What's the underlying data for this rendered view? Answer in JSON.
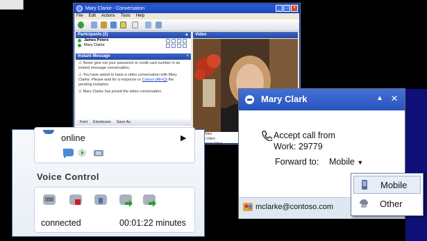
{
  "conversation_window": {
    "title": "Mary Clarke - Conversation",
    "menu": [
      "File",
      "Edit",
      "Actions",
      "Tools",
      "Help"
    ],
    "participants_header": "Participants (2)",
    "participants": [
      "James Peters",
      "Mary Clarke"
    ],
    "instant_message_header": "Instant Message",
    "messages": [
      "Never give out your password or credit card number in an instant message conversation.",
      "You have asked to have a video conversation with Mary Clarke. Please wait for a response or",
      "Cancel (Alt+Q)",
      "the pending invitation.",
      "Mary Clarke has joined the video conversation."
    ],
    "im_toolbar": [
      "Font",
      "Emoticons",
      "Save As"
    ],
    "video_header": "Video",
    "video_links": [
      "Stop Video",
      "Switch Video",
      "Full Screen Video"
    ]
  },
  "voice_panel": {
    "presence_status": "online",
    "section_title": "Voice Control",
    "call_status": "connected",
    "duration": "00:01:22 minutes"
  },
  "call_toast": {
    "caller_name": "Mary Clark",
    "accept_line1": "Accept call from",
    "accept_line2": "Work: 29779",
    "forward_label": "Forward to:",
    "forward_value": "Mobile",
    "email": "mclarke@contoso.com"
  },
  "forward_menu": {
    "options": [
      "Mobile",
      "Other"
    ],
    "selected": "Mobile"
  },
  "colors": {
    "titlebar_blue": "#2753bd",
    "desktop_navy": "#0f0f78",
    "presence_green": "#2fa32f"
  }
}
